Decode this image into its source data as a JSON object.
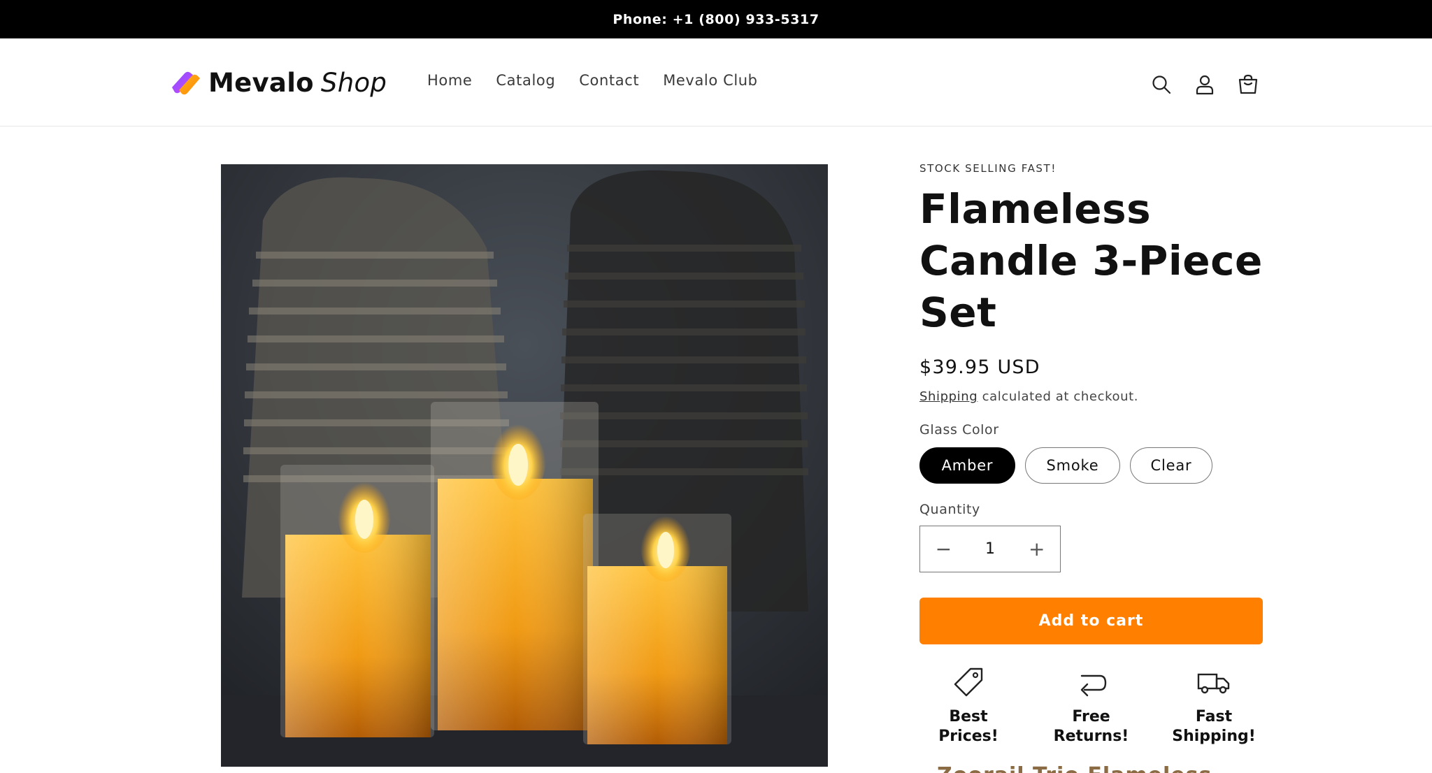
{
  "announcement": {
    "text": "Phone: +1 (800) 933-5317"
  },
  "header": {
    "brand": {
      "name": "Mevalo",
      "suffix": "Shop"
    },
    "nav": [
      {
        "label": "Home"
      },
      {
        "label": "Catalog"
      },
      {
        "label": "Contact"
      },
      {
        "label": "Mevalo Club"
      }
    ],
    "icons": [
      "search-icon",
      "account-icon",
      "cart-icon"
    ]
  },
  "product": {
    "badge": "STOCK SELLING FAST!",
    "title": "Flameless Candle 3-Piece Set",
    "price": "$39.95 USD",
    "shipping_link": "Shipping",
    "shipping_note": "calculated at checkout.",
    "option_label": "Glass Color",
    "options": [
      {
        "label": "Amber",
        "selected": true
      },
      {
        "label": "Smoke",
        "selected": false
      },
      {
        "label": "Clear",
        "selected": false
      }
    ],
    "quantity_label": "Quantity",
    "quantity_value": "1",
    "add_to_cart": "Add to cart",
    "perks": [
      {
        "icon": "price-tag-icon",
        "label": "Best Prices!"
      },
      {
        "icon": "return-arrow-icon",
        "label": "Free Returns!"
      },
      {
        "icon": "truck-icon",
        "label": "Fast Shipping!"
      }
    ],
    "teaser": "Zoorail Trio Flameless Candles"
  },
  "colors": {
    "accent": "#ff7f00",
    "announcement_bg": "#000000",
    "selected_pill": "#000000",
    "teaser": "#8b6b43"
  }
}
